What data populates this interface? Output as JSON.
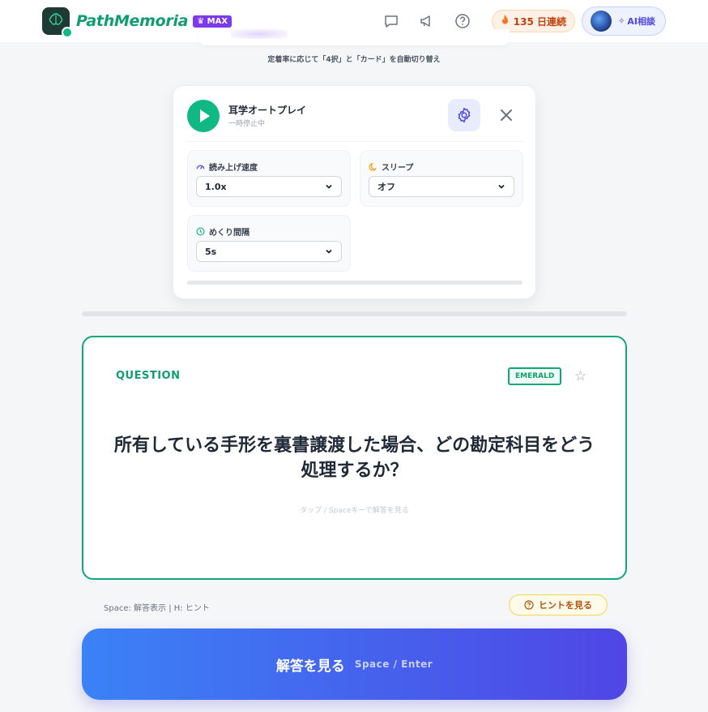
{
  "header": {
    "brand": "PathMemoria",
    "plan_badge": "MAX",
    "streak_label": "135 日連続",
    "ai_button_label": "AI相談",
    "icons": [
      "chat-icon",
      "megaphone-icon",
      "help-icon"
    ]
  },
  "mode_subtitle": "定着率に応じて「4択」と「カード」を自動切り替え",
  "autoplay": {
    "title": "耳学オートプレイ",
    "status": "一時停止中",
    "settings": {
      "speed": {
        "label": "読み上げ速度",
        "value": "1.0x"
      },
      "sleep": {
        "label": "スリープ",
        "value": "オフ"
      },
      "interval": {
        "label": "めくり間隔",
        "value": "5s"
      }
    }
  },
  "card": {
    "section_label": "QUESTION",
    "level_badge": "EMERALD",
    "question": "所有している手形を裏書譲渡した場合、どの勘定科目をどう処理するか？",
    "tap_hint": "タップ / Spaceキーで解答を見る"
  },
  "shortcuts": "Space: 解答表示 | H: ヒント",
  "hint_button_label": "ヒントを見る",
  "answer_button": {
    "label": "解答を見る",
    "key_hint": "Space / Enter"
  },
  "colors": {
    "accent_green": "#10a874",
    "accent_indigo": "#4f46e5",
    "gradient_start": "#3b82f6",
    "streak_orange": "#f97316"
  }
}
